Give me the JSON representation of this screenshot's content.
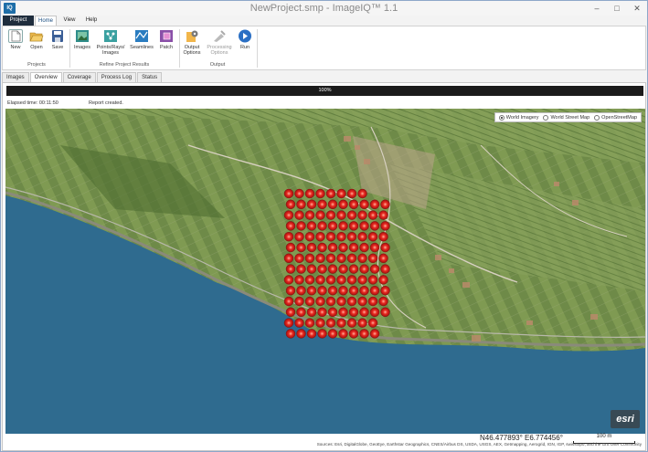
{
  "window": {
    "app_icon_text": "IQ",
    "title": "NewProject.smp - ImageIQ™ 1.1",
    "controls": [
      "–",
      "□",
      "✕"
    ]
  },
  "ribbon_tabs": [
    "Project",
    "Home",
    "View",
    "Help"
  ],
  "ribbon": {
    "projects_group": {
      "label": "Projects",
      "buttons": [
        "New",
        "Open",
        "Save"
      ]
    },
    "refine_group": {
      "label": "Refine Project Results",
      "buttons": [
        "Images",
        "Points/Rays/ Images",
        "Seamlines",
        "Patch"
      ]
    },
    "output_group": {
      "label": "Output",
      "buttons": [
        "Output Options",
        "Processing Options",
        "Run"
      ]
    }
  },
  "doc_tabs": [
    "Images",
    "Overview",
    "Coverage",
    "Process Log",
    "Status"
  ],
  "active_doc_tab": "Overview",
  "progress": {
    "label": "100%",
    "value": 1.0
  },
  "status": {
    "elapsed": "Elapsed time: 00:11:50",
    "message": "Report created."
  },
  "basemap": {
    "options": [
      "World Imagery",
      "World Street Map",
      "OpenStreetMap"
    ],
    "selected": "World Imagery"
  },
  "map": {
    "logo": "esri",
    "latitude": "N46.477893°",
    "longitude": "E6.774456°",
    "scale_label": "100 m",
    "attribution": "Sources: Esri, DigitalGlobe, GeoEye, Earthstar Geographics, CNES/Airbus DS, USDA, USGS, AEX, Getmapping, Aerogrid, IGN, IGP, swisstopo, and the GIS User Community"
  },
  "colors": {
    "accent": "#1c4f82",
    "project_tab": "#1f2d3d",
    "marker": "#e0201c",
    "lake": "#2f6b8f"
  },
  "icons": [
    "new-icon",
    "open-icon",
    "save-icon",
    "images-icon",
    "points-rays-icon",
    "seamlines-icon",
    "patch-icon",
    "output-options-icon",
    "processing-options-icon",
    "run-icon"
  ]
}
